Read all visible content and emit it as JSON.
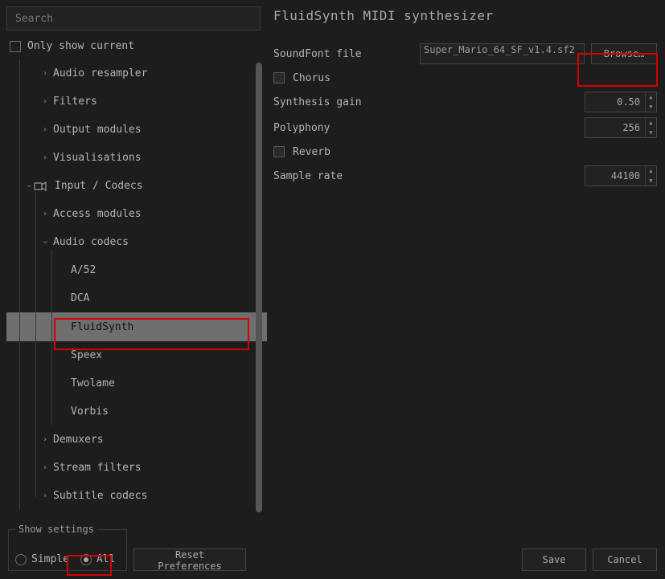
{
  "search": {
    "placeholder": "Search"
  },
  "only_show_current": "Only show current",
  "tree": {
    "audio_resampler": "Audio resampler",
    "filters": "Filters",
    "output_modules": "Output modules",
    "visualisations": "Visualisations",
    "input_codecs": "Input / Codecs",
    "access_modules": "Access modules",
    "audio_codecs": "Audio codecs",
    "a52": "A/52",
    "dca": "DCA",
    "fluidsynth": "FluidSynth",
    "speex": "Speex",
    "twolame": "Twolame",
    "vorbis": "Vorbis",
    "demuxers": "Demuxers",
    "stream_filters": "Stream filters",
    "subtitle_codecs": "Subtitle codecs"
  },
  "pane": {
    "title": "FluidSynth MIDI synthesizer",
    "soundfont_label": "SoundFont file",
    "soundfont_value": "Super_Mario_64_SF_v1.4.sf2",
    "browse": "Browse…",
    "chorus": "Chorus",
    "synthesis_gain": "Synthesis gain",
    "synthesis_gain_value": "0.50",
    "polyphony": "Polyphony",
    "polyphony_value": "256",
    "reverb": "Reverb",
    "sample_rate": "Sample rate",
    "sample_rate_value": "44100"
  },
  "footer": {
    "show_settings": "Show settings",
    "simple": "Simple",
    "all": "All",
    "reset": "Reset Preferences",
    "save": "Save",
    "cancel": "Cancel"
  }
}
